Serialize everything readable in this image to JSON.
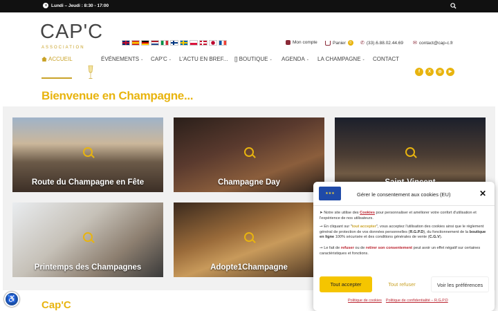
{
  "topbar": {
    "hours": "Lundi – Jeudi : 8:30 - 17:00"
  },
  "logo": {
    "name": "CAP'C",
    "sub": "ASSOCIATION"
  },
  "header": {
    "account": "Mon compte",
    "cart": "Panier",
    "cart_count": "0",
    "phone": "(33).6.88.02.44.69",
    "email": "contact@cap-c.fr"
  },
  "nav": {
    "home": "ACCUEIL",
    "events": "ÉVÉNEMENTS",
    "capc": "CAP'C",
    "news": "L'ACTU EN BREF...",
    "shop": "[] BOUTIQUE",
    "agenda": "AGENDA",
    "champagne": "LA CHAMPAGNE",
    "contact": "CONTACT"
  },
  "welcome": "Bienvenue en Champagne...",
  "tiles": [
    {
      "label": "Route du Champagne en Fête"
    },
    {
      "label": "Champagne Day"
    },
    {
      "label": "Saint-Vincent"
    },
    {
      "label": "Printemps des Champagnes"
    },
    {
      "label": "Adopte1Champagne"
    }
  ],
  "section2": "Cap'C",
  "cookie": {
    "title": "Gérer le consentement aux cookies (EU)",
    "p1a": "➤ Notre site utilise des ",
    "p1b": "Cookies",
    "p1c": " pour personnaliser et améliorer votre confort d'utilisation et l'expérience de nos utilisateurs.",
    "p2a": "➙ En cliquant sur \"",
    "p2b": "tout accepter",
    "p2c": "\", vous acceptez l'utilisation des cookies ainsi que le règlement général de protection de vos données personnelles (",
    "p2d": "R.G.P.D",
    "p2e": "), du fonctionnement de la ",
    "p2f": "boutique en ligne",
    "p2g": " 100% sécurisée et des conditions générales de vente (",
    "p2h": "C.G.V",
    "p2i": ").",
    "p3a": "➙ Le fait de ",
    "p3b": "refuser",
    "p3c": " ou de ",
    "p3d": "retirer son consentement",
    "p3e": " peut avoir un effet négatif sur certaines caractéristiques et fonctions.",
    "accept": "Tout accepter",
    "refuse": "Tout refuser",
    "prefs": "Voir les préférences",
    "link1": "Politique de cookies",
    "link2": "Politique de confidentialité – R.G.P.D"
  },
  "colors": {
    "accent": "#e8b40f",
    "dark": "#111111",
    "wine": "#8a2a38"
  }
}
